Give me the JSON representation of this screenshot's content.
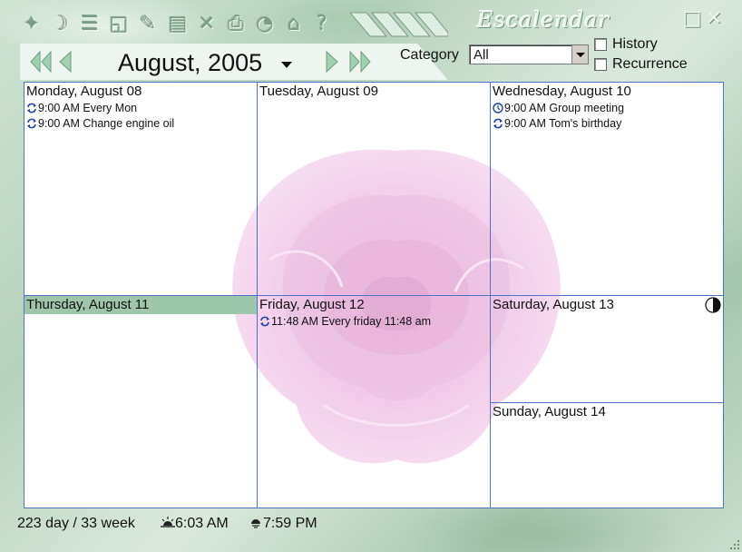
{
  "app": {
    "title": "Escalendar"
  },
  "toolbar": {
    "icons": [
      "star-icon",
      "moon-icon",
      "list-icon",
      "note-icon",
      "pencil-icon",
      "document-icon",
      "delete-icon",
      "print-icon",
      "alarm-icon",
      "home-icon",
      "help-icon"
    ]
  },
  "window": {
    "restore": "□",
    "close": "✕"
  },
  "header": {
    "month_label": "August, 2005"
  },
  "category": {
    "label": "Category",
    "value": "All",
    "history_label": "History",
    "recurrence_label": "Recurrence"
  },
  "days": [
    {
      "label": "Monday, August 08",
      "events": [
        {
          "time": "9:00 AM",
          "text": "Every Mon",
          "icon": "recurring-icon"
        },
        {
          "time": "9:00 AM",
          "text": "Change engine oil",
          "icon": "recurring-icon"
        }
      ]
    },
    {
      "label": "Tuesday, August 09",
      "events": []
    },
    {
      "label": "Wednesday, August 10",
      "events": [
        {
          "time": "9:00 AM",
          "text": "Group meeting",
          "icon": "clock-icon"
        },
        {
          "time": "9:00 AM",
          "text": "Tom's birthday",
          "icon": "recurring-icon"
        }
      ]
    },
    {
      "label": "Thursday, August 11",
      "today": true,
      "events": []
    },
    {
      "label": "Friday, August 12",
      "events": [
        {
          "time": "11:48 AM",
          "text": "Every friday 11:48 am",
          "icon": "recurring-icon"
        }
      ]
    },
    {
      "label": "Saturday, August 13",
      "events": [],
      "moon": "half-moon-icon"
    },
    {
      "label": "Sunday, August 14",
      "events": []
    }
  ],
  "status": {
    "day_week": "223 day / 33 week",
    "sunrise": "6:03 AM",
    "sunset": "7:59 PM"
  },
  "colors": {
    "grid_line": "#4f72c9",
    "today_bg": "#9ec6ab",
    "event_icon": "#1f3fae"
  }
}
